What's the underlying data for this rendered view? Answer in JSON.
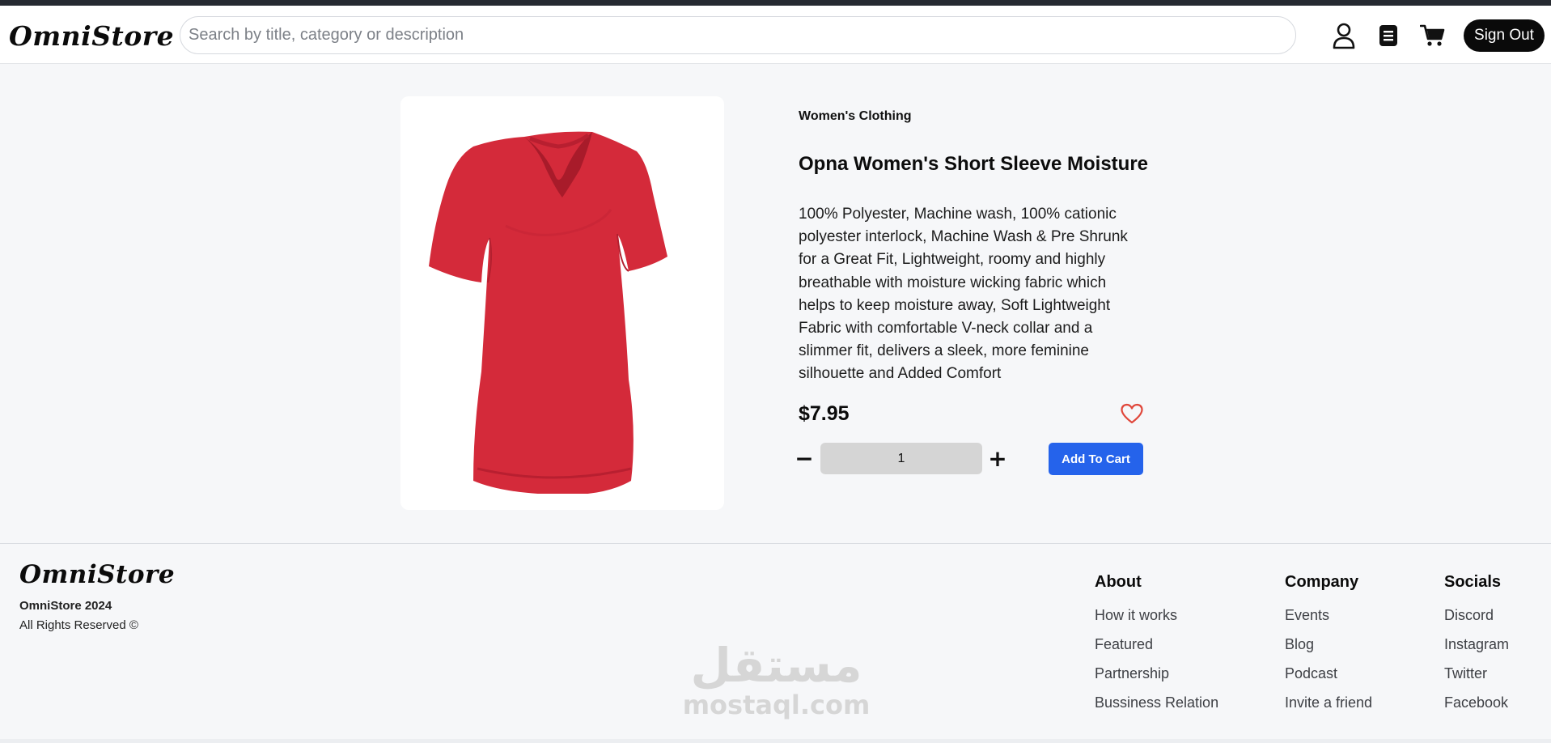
{
  "header": {
    "logo": "OmniStore",
    "search_placeholder": "Search by title, category or description",
    "icons": [
      "user-icon",
      "orders-icon",
      "cart-icon"
    ],
    "signout_label": "Sign Out"
  },
  "product": {
    "category": "Women's Clothing",
    "title": "Opna Women's Short Sleeve Moisture",
    "description": "100% Polyester, Machine wash, 100% cationic polyester interlock, Machine Wash & Pre Shrunk for a Great Fit, Lightweight, roomy and highly breathable with moisture wicking fabric which helps to keep moisture away, Soft Lightweight Fabric with comfortable V-neck collar and a slimmer fit, delivers a sleek, more feminine silhouette and Added Comfort",
    "price": "$7.95",
    "quantity": "1",
    "minus_label": "−",
    "plus_label": "+",
    "add_to_cart_label": "Add To Cart",
    "shirt_color": "#d42a3a",
    "heart_color": "#e0473b"
  },
  "footer": {
    "logo": "OmniStore",
    "copy_line1": "OmniStore 2024",
    "copy_line2": "All Rights Reserved ©",
    "columns": [
      {
        "title": "About",
        "links": [
          "How it works",
          "Featured",
          "Partnership",
          "Bussiness Relation"
        ]
      },
      {
        "title": "Company",
        "links": [
          "Events",
          "Blog",
          "Podcast",
          "Invite a friend"
        ]
      },
      {
        "title": "Socials",
        "links": [
          "Discord",
          "Instagram",
          "Twitter",
          "Facebook"
        ]
      }
    ],
    "watermark_ar": "مستقل",
    "watermark_en": "mostaql.com"
  },
  "colors": {
    "accent": "#2563eb",
    "page_bg": "#f6f7f9",
    "dark": "#0a0a0a"
  }
}
